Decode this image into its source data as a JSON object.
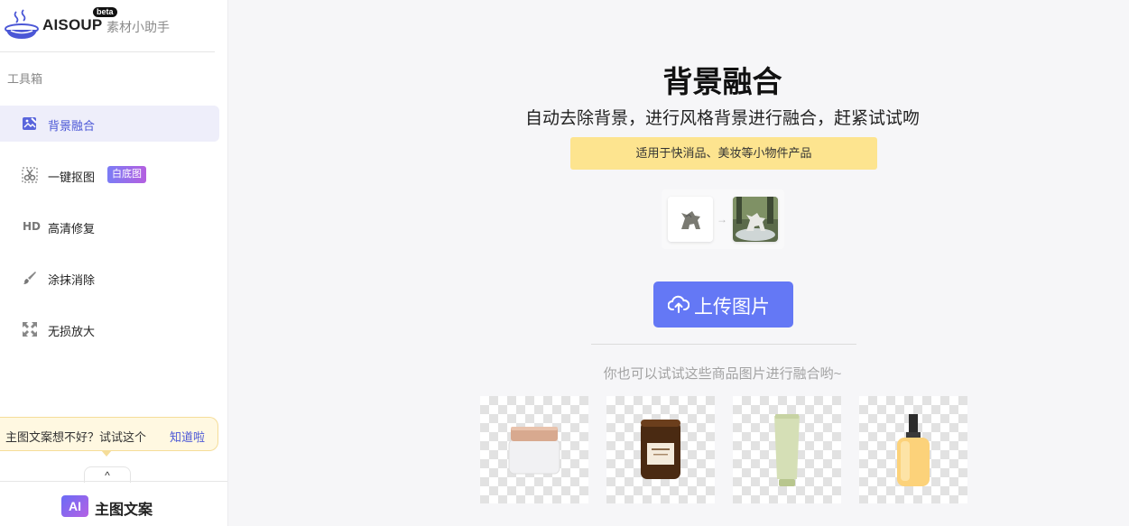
{
  "logo": {
    "name": "AISOUP",
    "badge": "beta",
    "subtitle": "素材小助手"
  },
  "sidebar": {
    "section_title": "工具箱",
    "items": [
      {
        "label": "背景融合",
        "icon": "image-edit-icon",
        "active": true
      },
      {
        "label": "一键抠图",
        "icon": "scissors-icon",
        "badge": "白底图"
      },
      {
        "label": "高清修复",
        "icon": "hd-icon",
        "icon_text": "HD"
      },
      {
        "label": "涂抹消除",
        "icon": "brush-icon"
      },
      {
        "label": "无损放大",
        "icon": "expand-icon"
      }
    ],
    "tip": {
      "text": "主图文案想不好？试试这个",
      "link": "知道啦"
    },
    "collapse_glyph": "^",
    "ai_section": {
      "badge": "AI",
      "label": "主图文案"
    }
  },
  "main": {
    "title": "背景融合",
    "subtitle": "自动去除背景，进行风格背景进行融合，赶紧试试吻",
    "note": "适用于快消品、美妆等小物件产品",
    "demo": {
      "arrow": "→",
      "before": "figurine-cutout",
      "after": "figurine-scene"
    },
    "upload_button": {
      "label": "上传图片",
      "icon": "cloud-upload-icon"
    },
    "sample_hint": "你也可以试试这些商品图片进行融合哟~",
    "samples": [
      {
        "name": "cream-jar"
      },
      {
        "name": "candle-jar"
      },
      {
        "name": "cream-tube"
      },
      {
        "name": "pump-bottle"
      }
    ]
  },
  "colors": {
    "accent": "#6478f5",
    "active_text": "#4b57d6",
    "note_bg": "#fde48f",
    "tip_bg": "#fff8e1"
  }
}
